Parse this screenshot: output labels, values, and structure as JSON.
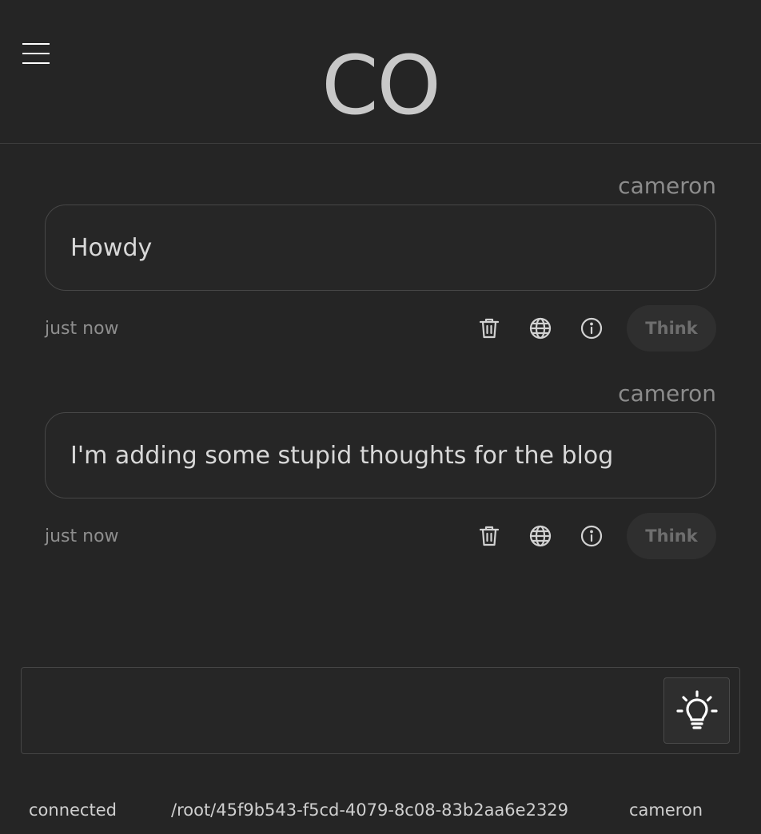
{
  "header": {
    "logo": "CO",
    "menu_icon": "hamburger-menu-icon"
  },
  "messages": [
    {
      "author": "cameron",
      "text": "Howdy",
      "time": "just now",
      "think_label": "Think"
    },
    {
      "author": "cameron",
      "text": "I'm adding some stupid thoughts for the blog",
      "time": "just now",
      "think_label": "Think"
    }
  ],
  "message_actions": [
    "trash-icon",
    "globe-icon",
    "info-icon"
  ],
  "composer": {
    "value": "",
    "placeholder": "",
    "submit_icon": "lightbulb-icon"
  },
  "statusbar": {
    "connection": "connected",
    "path": "/root/45f9b543-f5cd-4079-8c08-83b2aa6e2329",
    "user": "cameron"
  },
  "colors": {
    "background": "#252525",
    "text": "#d6d6d6",
    "muted": "#8c8c8c",
    "border": "#474747"
  }
}
